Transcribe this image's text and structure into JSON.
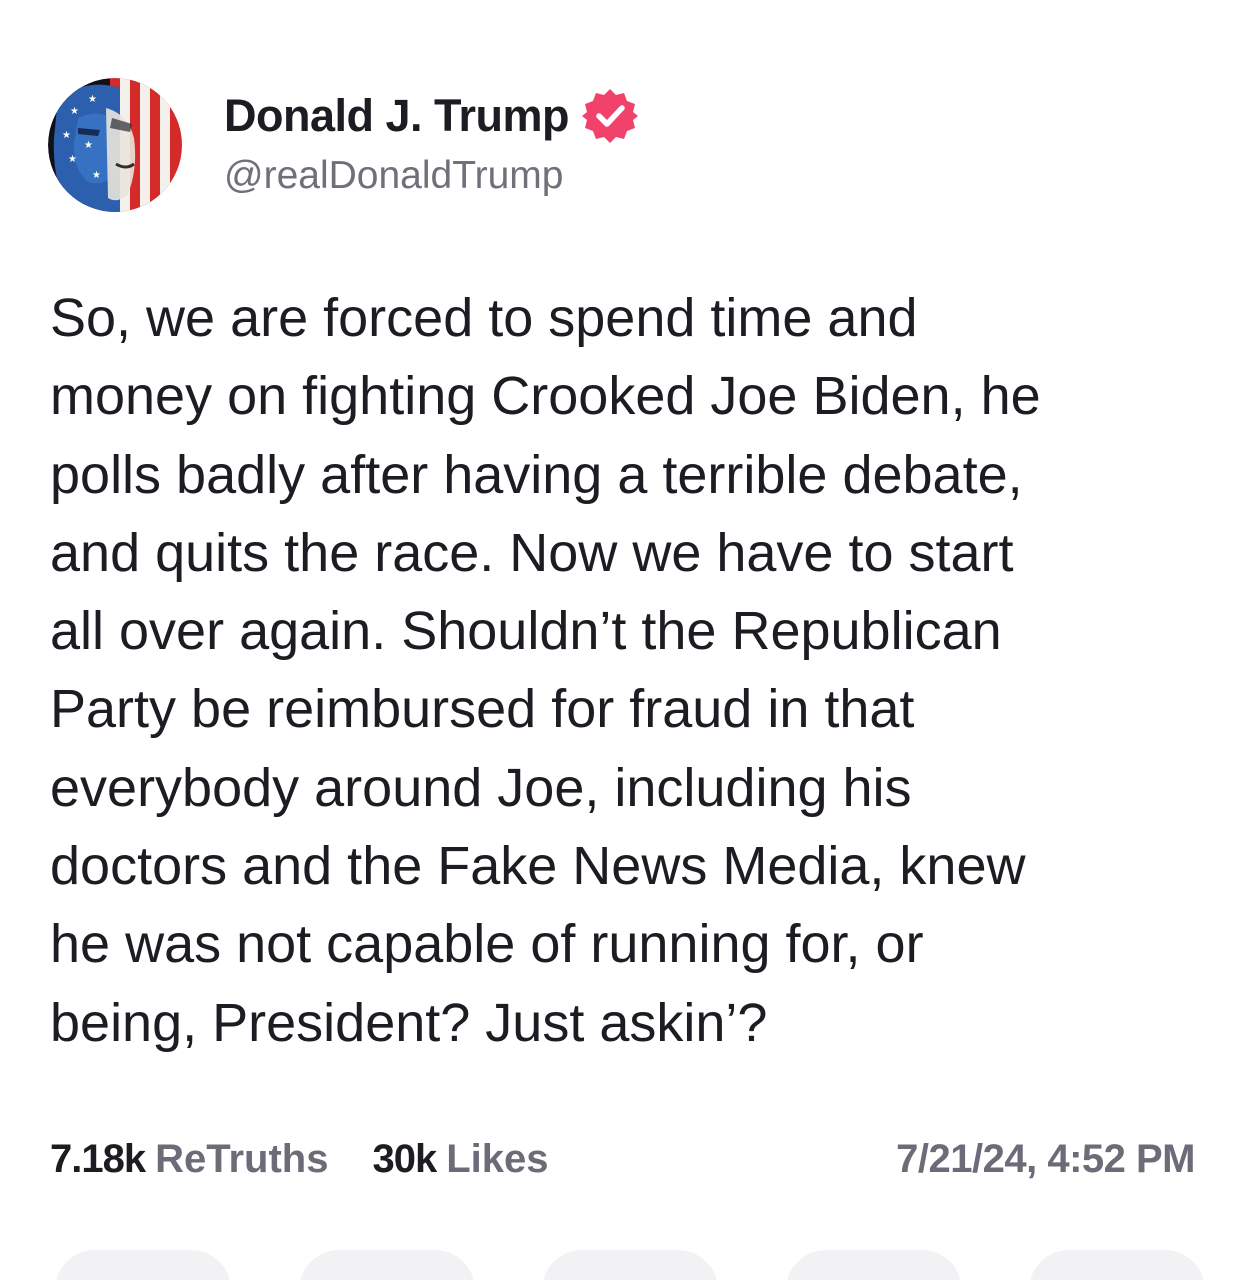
{
  "author": {
    "display_name": "Donald J. Trump",
    "handle": "@realDonaldTrump",
    "verified": true,
    "avatar_icon": "flag-portrait-avatar",
    "badge_color": "#f0426a"
  },
  "post": {
    "text": "So, we are forced to spend time and\nmoney on fighting Crooked Joe Biden, he\npolls badly after having a terrible debate,\nand quits the race. Now we have to start\nall over again. Shouldn’t the Republican\nParty be reimbursed for fraud in that\neverybody around Joe, including his\ndoctors and the Fake News Media, knew\nhe was not capable of running for, or\nbeing, President? Just askin’?"
  },
  "stats": {
    "retruths_count": "7.18k",
    "retruths_label": "ReTruths",
    "likes_count": "30k",
    "likes_label": "Likes",
    "timestamp": "7/21/24, 4:52 PM"
  },
  "colors": {
    "text_primary": "#1c1c22",
    "text_secondary": "#6c6c78",
    "action_bg": "#f2f2f4"
  }
}
